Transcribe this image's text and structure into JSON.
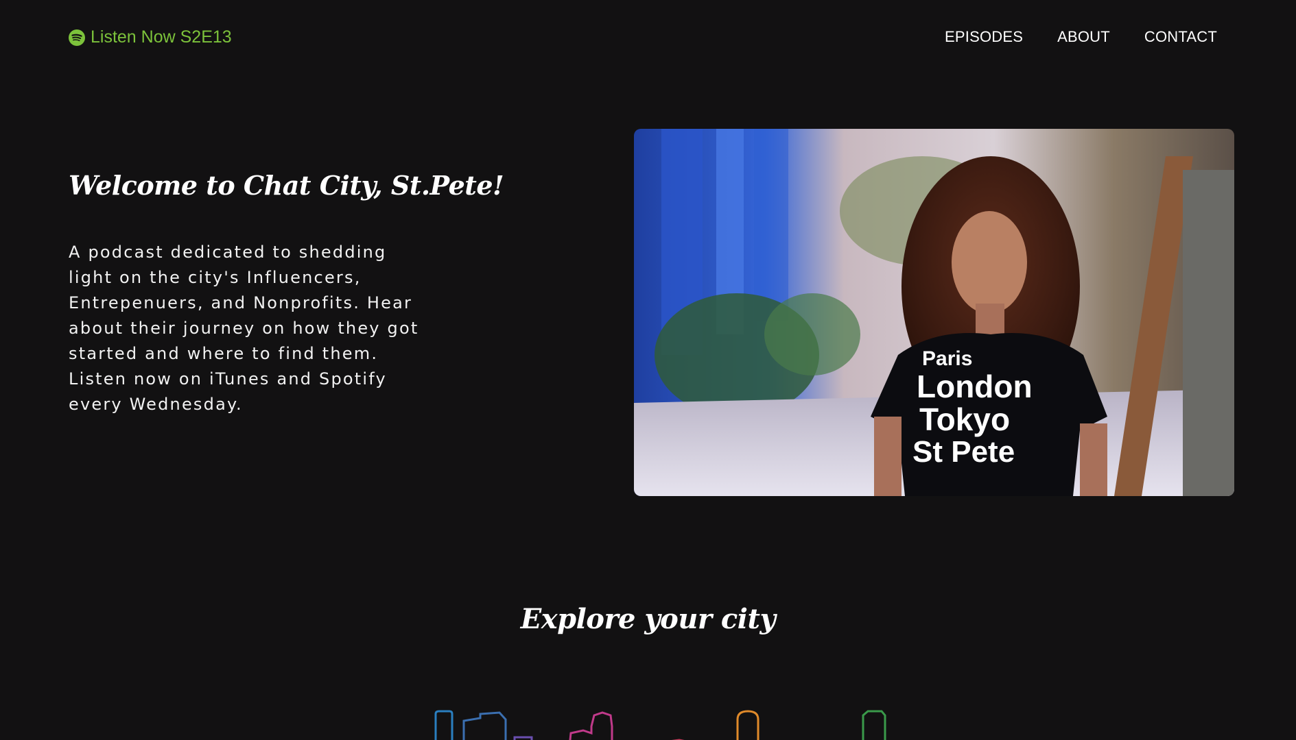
{
  "header": {
    "brand_label": "Listen Now S2E13",
    "brand_icon": "spotify-icon",
    "brand_color": "#7cc23b",
    "nav": [
      {
        "label": "EPISODES"
      },
      {
        "label": "ABOUT"
      },
      {
        "label": "CONTACT"
      }
    ]
  },
  "hero": {
    "title": "Welcome to Chat City, St.Pete!",
    "description": "A podcast dedicated to shedding light on the city's Influencers, Entrepenuers, and Nonprofits. Hear about their journey on how they got started and where to find them. Listen now on iTunes and Spotify every Wednesday.",
    "photo_shirt_lines": [
      "Paris",
      "London",
      "Tokyo",
      "St Pete"
    ]
  },
  "explore": {
    "title": "Explore your city",
    "skyline_colors": [
      "#2a7fc0",
      "#3b6fb0",
      "#6a4fb0",
      "#c03a8a",
      "#c83a5a",
      "#e08a2a",
      "#3a9a4a"
    ]
  },
  "colors": {
    "background": "#121112",
    "text": "#ffffff",
    "accent": "#7cc23b"
  }
}
